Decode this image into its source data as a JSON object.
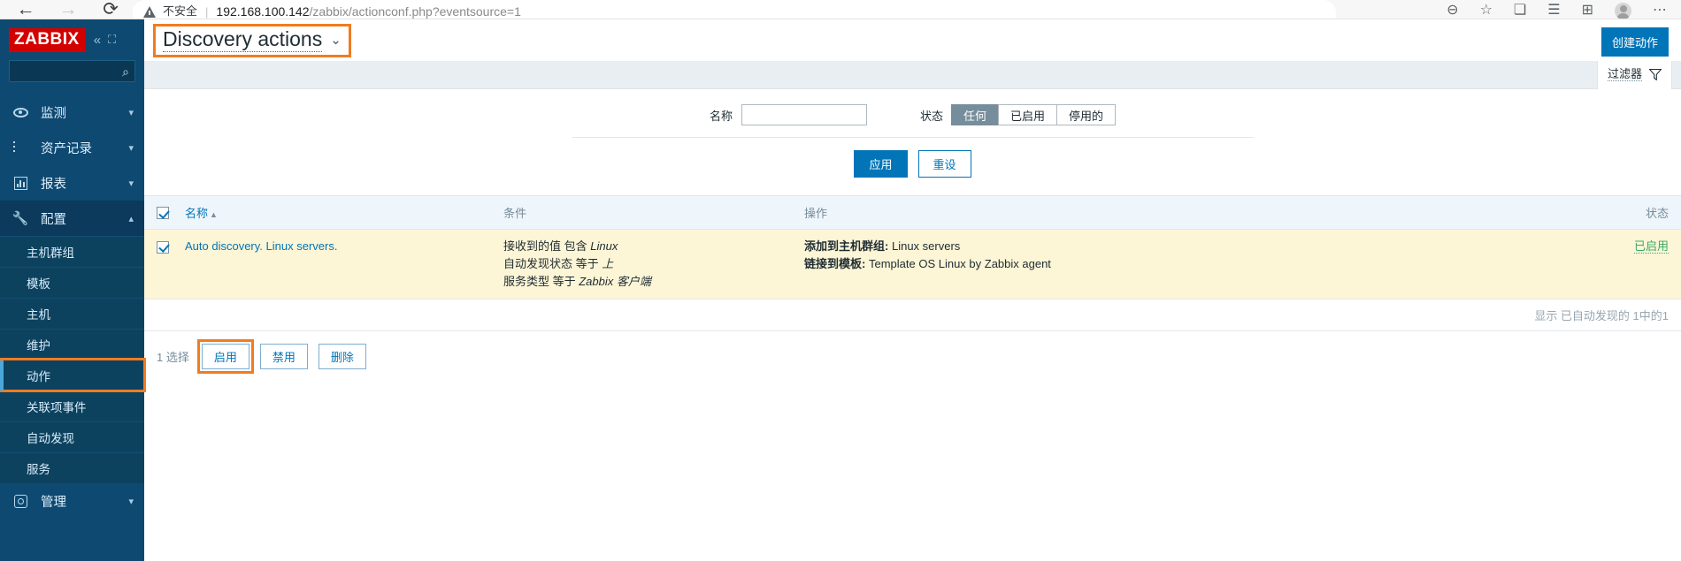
{
  "browser": {
    "back_icon": "back-arrow-icon",
    "forward_icon": "forward-arrow-icon",
    "reload_icon": "reload-icon",
    "security_label": "不安全",
    "url_host": "192.168.100.142",
    "url_path": "/zabbix/actionconf.php?eventsource=1",
    "right_icons": [
      "zoom-out-icon",
      "add-favorite-icon",
      "collections-icon",
      "reading-list-icon",
      "add-tab-icon",
      "profile-avatar",
      "more-options-icon"
    ]
  },
  "sidebar": {
    "logo": "ZABBIX",
    "collapse_icon": "collapse-sidebar-icon",
    "expand_icon": "expand-sidebar-icon",
    "search_placeholder": "",
    "search_value": "",
    "search_icon": "search-icon",
    "menu": [
      {
        "label": "监测",
        "icon": "eye-icon",
        "chevron": "▾",
        "active": false
      },
      {
        "label": "资产记录",
        "icon": "list-icon",
        "chevron": "▾",
        "active": false
      },
      {
        "label": "报表",
        "icon": "report-chart-icon",
        "chevron": "▾",
        "active": false
      },
      {
        "label": "配置",
        "icon": "wrench-icon",
        "chevron": "▴",
        "active": true
      }
    ],
    "submenu": [
      {
        "label": "主机群组",
        "selected": false,
        "highlight": false
      },
      {
        "label": "模板",
        "selected": false,
        "highlight": false
      },
      {
        "label": "主机",
        "selected": false,
        "highlight": false
      },
      {
        "label": "维护",
        "selected": false,
        "highlight": false
      },
      {
        "label": "动作",
        "selected": true,
        "highlight": true
      },
      {
        "label": "关联项事件",
        "selected": false,
        "highlight": false
      },
      {
        "label": "自动发现",
        "selected": false,
        "highlight": false
      },
      {
        "label": "服务",
        "selected": false,
        "highlight": false
      }
    ],
    "admin": {
      "label": "管理",
      "icon": "gear-icon",
      "chevron": "▾"
    }
  },
  "header": {
    "title": "Discovery actions",
    "title_caret": "⌄",
    "create_button": "创建动作"
  },
  "filter": {
    "tab_label": "过滤器",
    "filter_icon": "funnel-icon",
    "name_label": "名称",
    "name_value": "",
    "name_placeholder": "",
    "status_label": "状态",
    "status_options": [
      "任何",
      "已启用",
      "停用的"
    ],
    "status_selected": "任何",
    "apply_button": "应用",
    "reset_button": "重设"
  },
  "table": {
    "headers": {
      "name": "名称",
      "name_sort": "▲",
      "conditions": "条件",
      "operations": "操作",
      "status": "状态"
    },
    "select_all_checked": true,
    "rows": [
      {
        "checked": true,
        "name": "Auto discovery. Linux servers.",
        "conditions": [
          {
            "prefix": "接收到的值 包含 ",
            "value": "Linux"
          },
          {
            "prefix": "自动发现状态 等于 ",
            "value": "上"
          },
          {
            "prefix": "服务类型 等于 ",
            "value": "Zabbix 客户端"
          }
        ],
        "operations": [
          {
            "label": "添加到主机群组:",
            "value": "Linux servers"
          },
          {
            "label": "链接到模板:",
            "value": "Template OS Linux by Zabbix agent"
          }
        ],
        "status": "已启用"
      }
    ],
    "footer_text": "显示 已自动发现的 1中的1"
  },
  "bulk": {
    "selected_count": "1 选择",
    "enable_button": "启用",
    "disable_button": "禁用",
    "delete_button": "删除"
  },
  "colors": {
    "accent": "#0275b8",
    "sidebar": "#0e4972",
    "logo_red": "#d40000",
    "highlight_orange": "#f07c21",
    "row_bg": "#fcf5d6",
    "status_green": "#3aaa64"
  }
}
